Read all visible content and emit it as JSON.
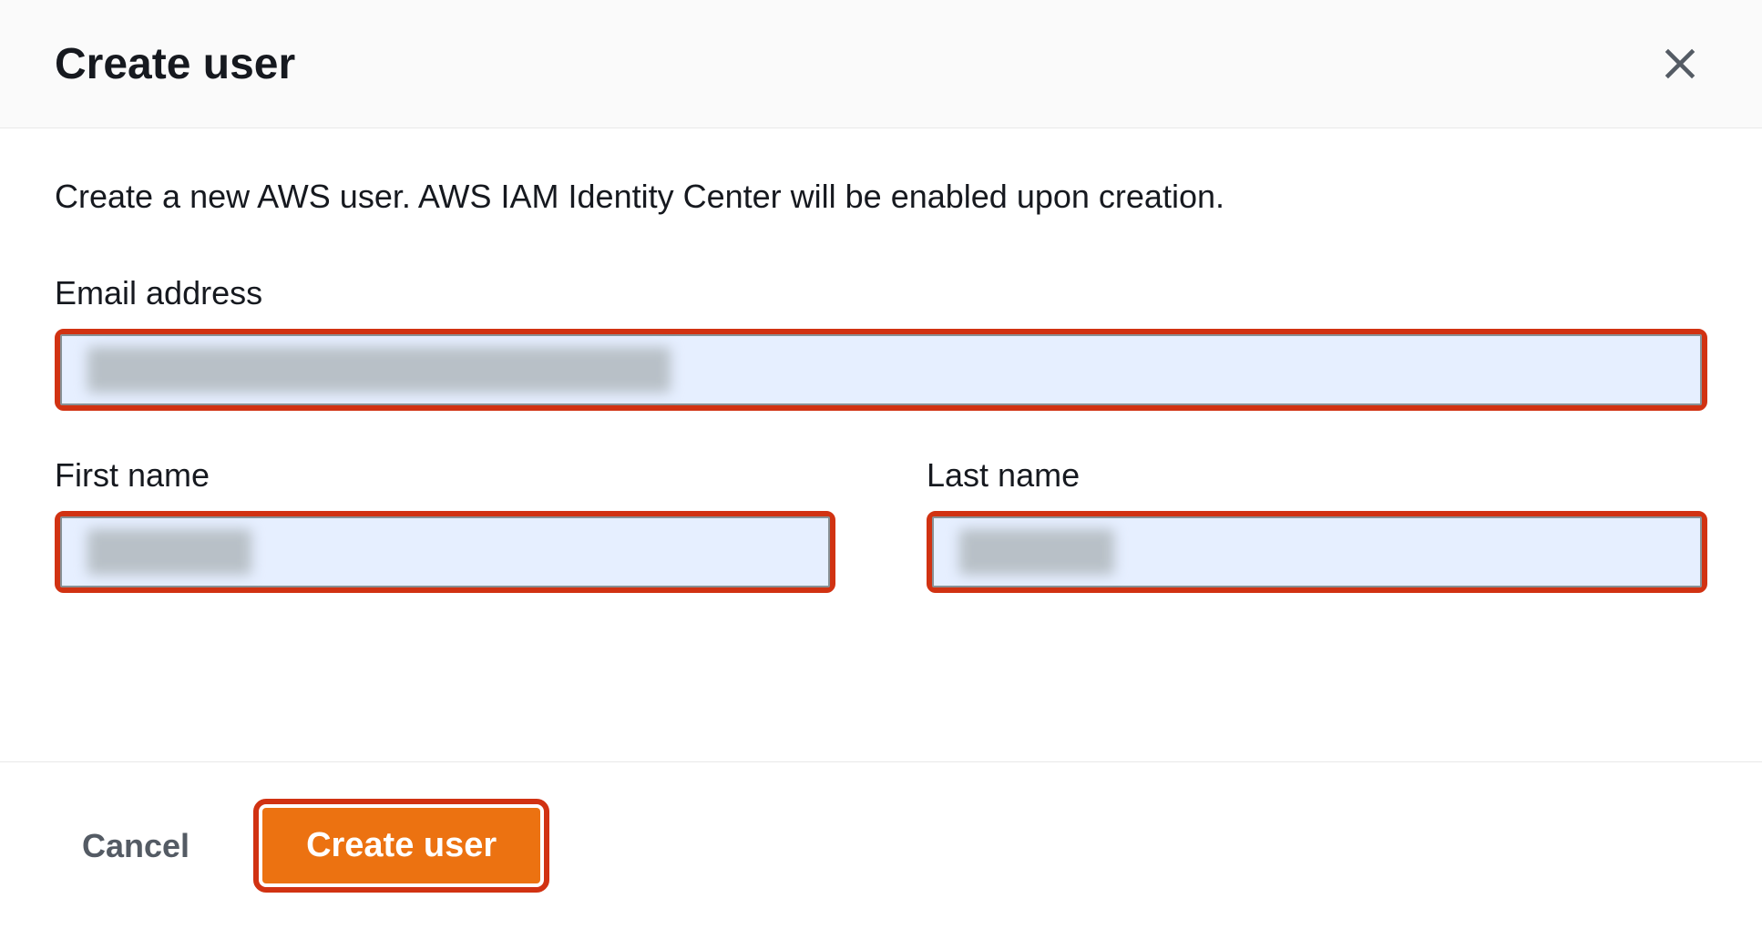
{
  "modal": {
    "title": "Create user",
    "description": "Create a new AWS user. AWS IAM Identity Center will be enabled upon creation.",
    "close_label": "Close"
  },
  "form": {
    "email": {
      "label": "Email address",
      "value": ""
    },
    "first_name": {
      "label": "First name",
      "value": ""
    },
    "last_name": {
      "label": "Last name",
      "value": ""
    }
  },
  "footer": {
    "cancel_label": "Cancel",
    "create_label": "Create user"
  },
  "colors": {
    "highlight_border": "#d13212",
    "primary_button": "#ec7211",
    "input_bg": "#e6efff"
  }
}
